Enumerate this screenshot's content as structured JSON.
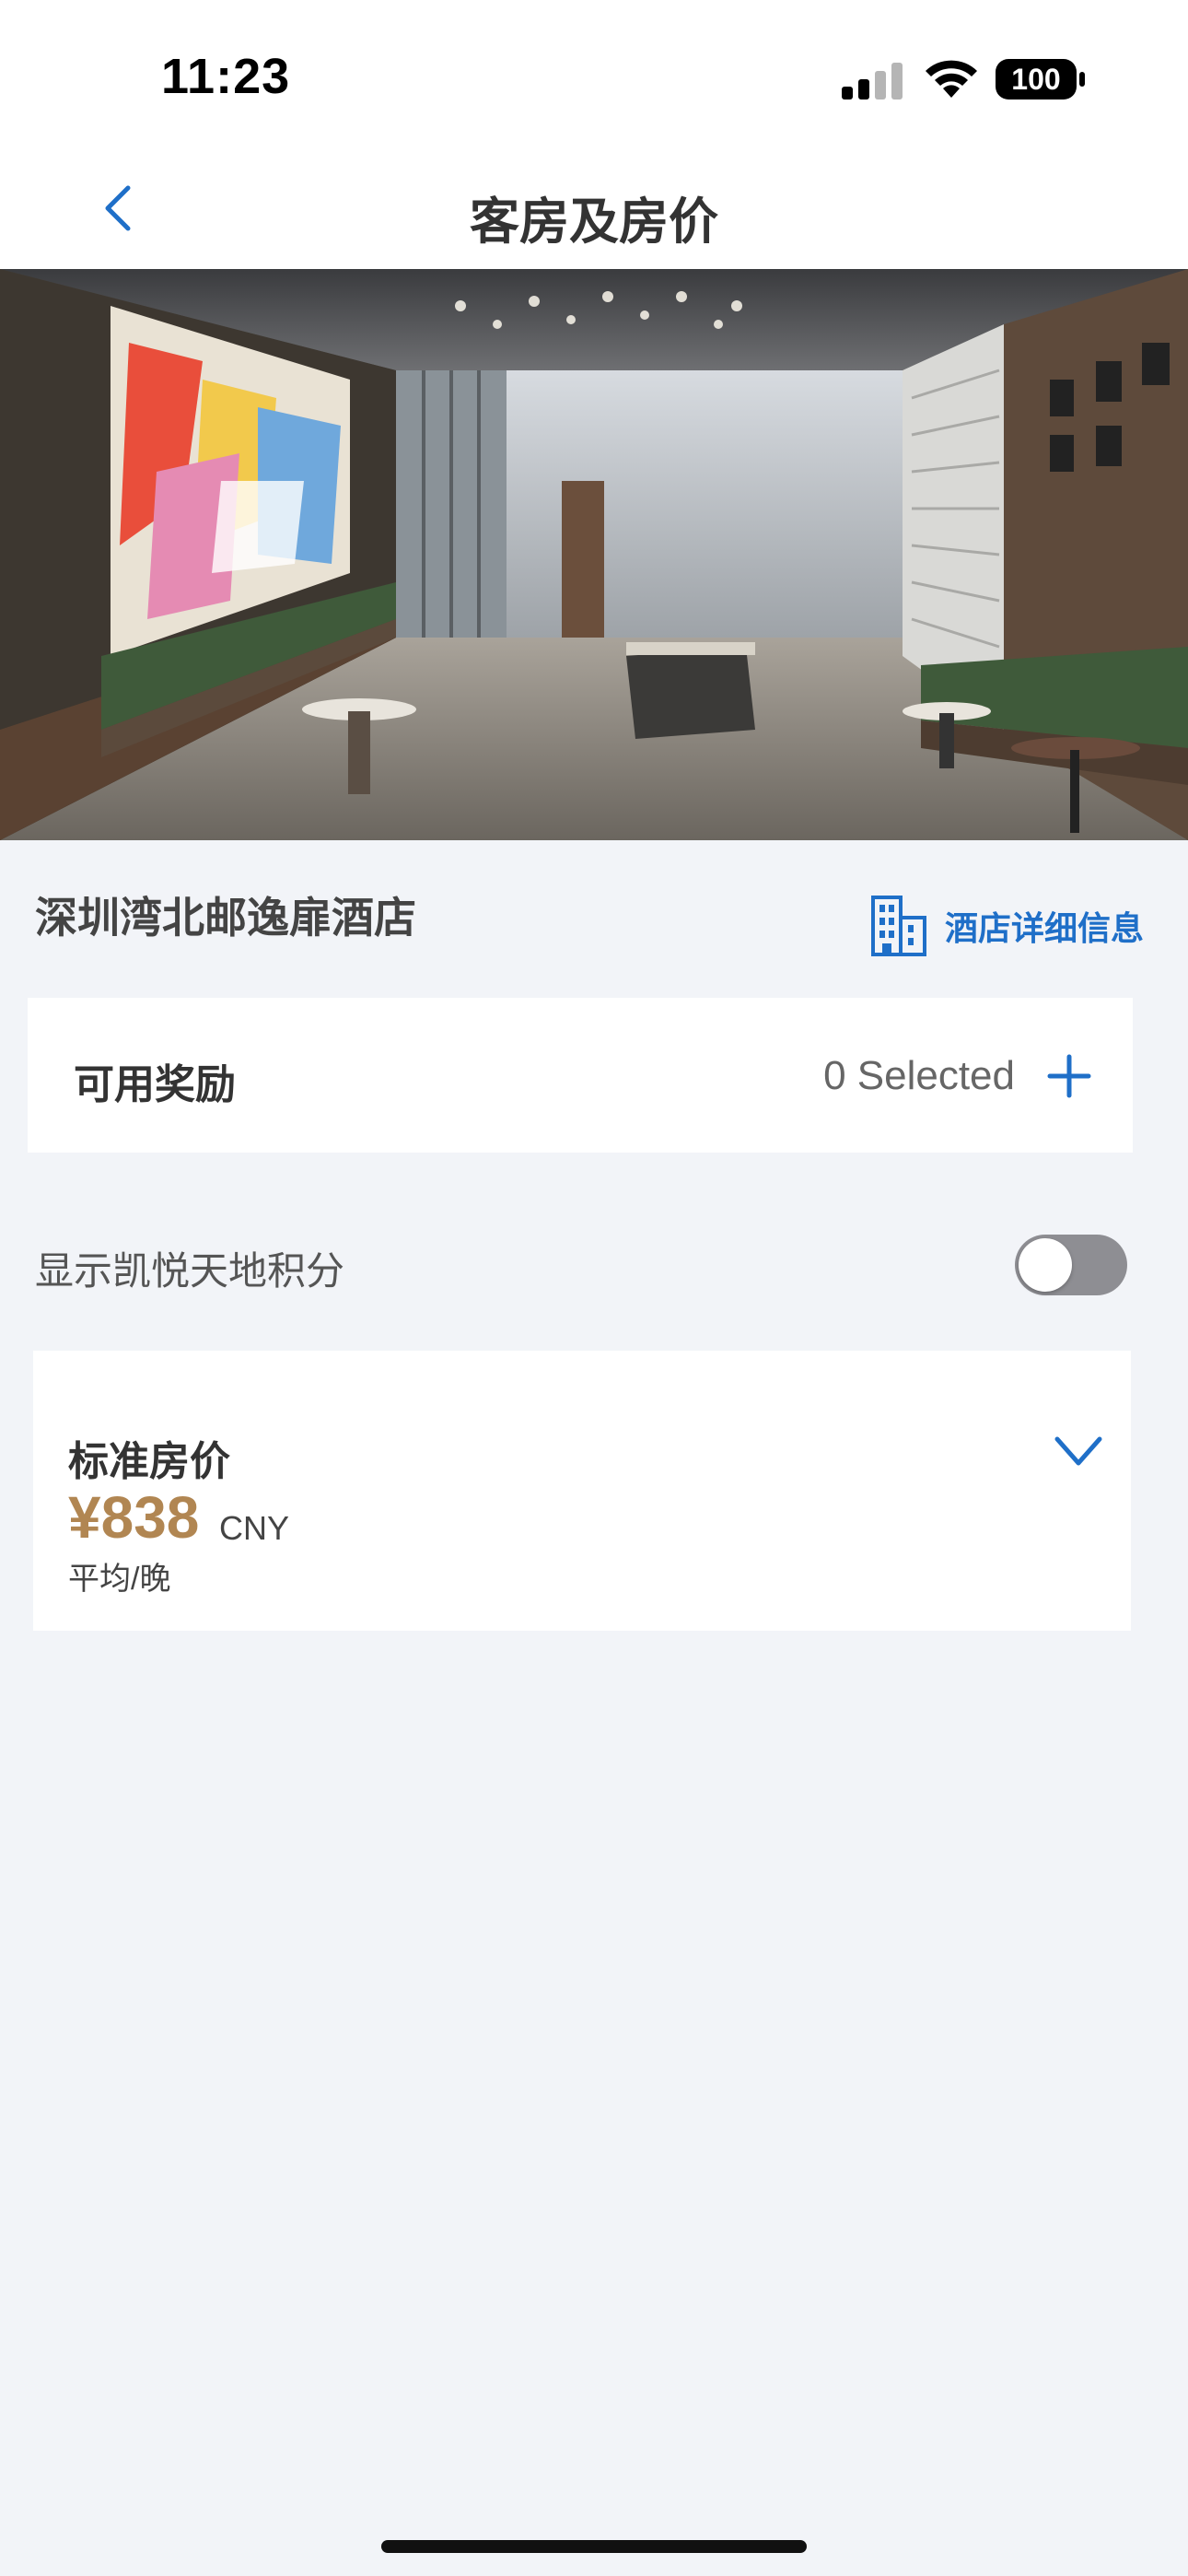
{
  "status_bar": {
    "time": "11:23",
    "battery": "100",
    "icons": [
      "signal-icon",
      "wifi-icon",
      "battery-icon"
    ]
  },
  "nav": {
    "title": "客房及房价",
    "back_icon": "chevron-left-icon"
  },
  "hotel": {
    "name": "深圳湾北邮逸扉酒店",
    "details_label": "酒店详细信息",
    "details_icon": "building-icon"
  },
  "rewards": {
    "title": "可用奖励",
    "count_label": "0 Selected",
    "add_icon": "plus-icon"
  },
  "points_toggle": {
    "label": "显示凯悦天地积分",
    "on": false
  },
  "rate": {
    "title": "标准房价",
    "price": "¥838",
    "currency": "CNY",
    "unit": "平均/晚",
    "expand_icon": "chevron-down-icon"
  },
  "colors": {
    "accent_blue": "#1f6fc8",
    "price_gold": "#b18652",
    "background": "#f2f4f8",
    "toggle_off": "#8e8e93"
  }
}
